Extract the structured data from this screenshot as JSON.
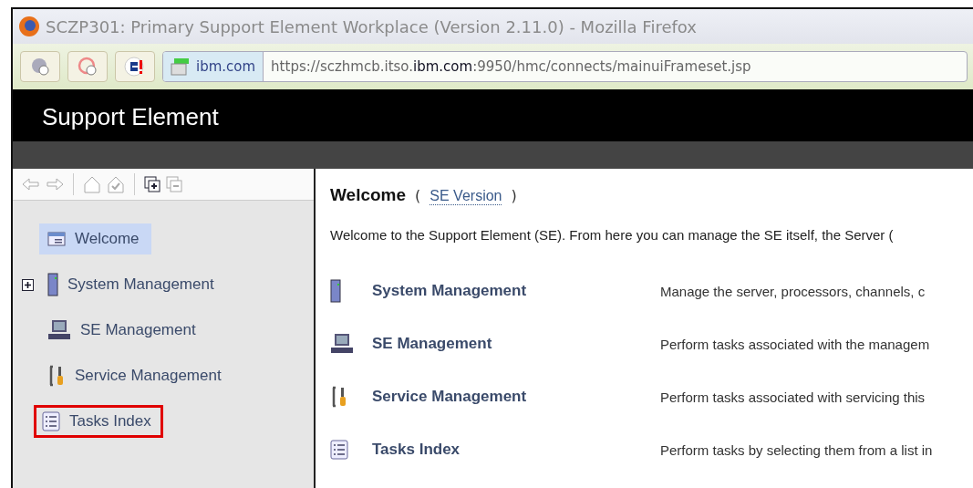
{
  "window": {
    "title": "SCZP301: Primary Support Element Workplace (Version 2.11.0) - Mozilla Firefox"
  },
  "address_bar": {
    "site": "ibm.com",
    "url_prefix": "https://sczhmcb.itso.",
    "url_domain": "ibm.com",
    "url_suffix": ":9950/hmc/connects/mainuiFrameset.jsp"
  },
  "banner": {
    "title": "Support Element"
  },
  "sidebar": {
    "items": [
      {
        "label": "Welcome",
        "selected": true,
        "highlighted": false
      },
      {
        "label": "System Management",
        "selected": false,
        "highlighted": false,
        "expanded": false
      },
      {
        "label": "SE Management",
        "selected": false,
        "highlighted": false
      },
      {
        "label": "Service Management",
        "selected": false,
        "highlighted": false
      },
      {
        "label": "Tasks Index",
        "selected": false,
        "highlighted": true
      }
    ]
  },
  "content": {
    "heading": "Welcome",
    "open_paren": "(",
    "version_link": "SE Version",
    "close_paren": ")",
    "intro": "Welcome to the Support Element (SE). From here you can manage the SE itself, the Server (",
    "tasks": [
      {
        "name": "System Management",
        "description": "Manage the server, processors, channels, c"
      },
      {
        "name": "SE Management",
        "description": "Perform tasks associated with the managem"
      },
      {
        "name": "Service Management",
        "description": "Perform tasks associated with servicing this"
      },
      {
        "name": "Tasks Index",
        "description": "Perform tasks by selecting them from a list in"
      }
    ]
  }
}
